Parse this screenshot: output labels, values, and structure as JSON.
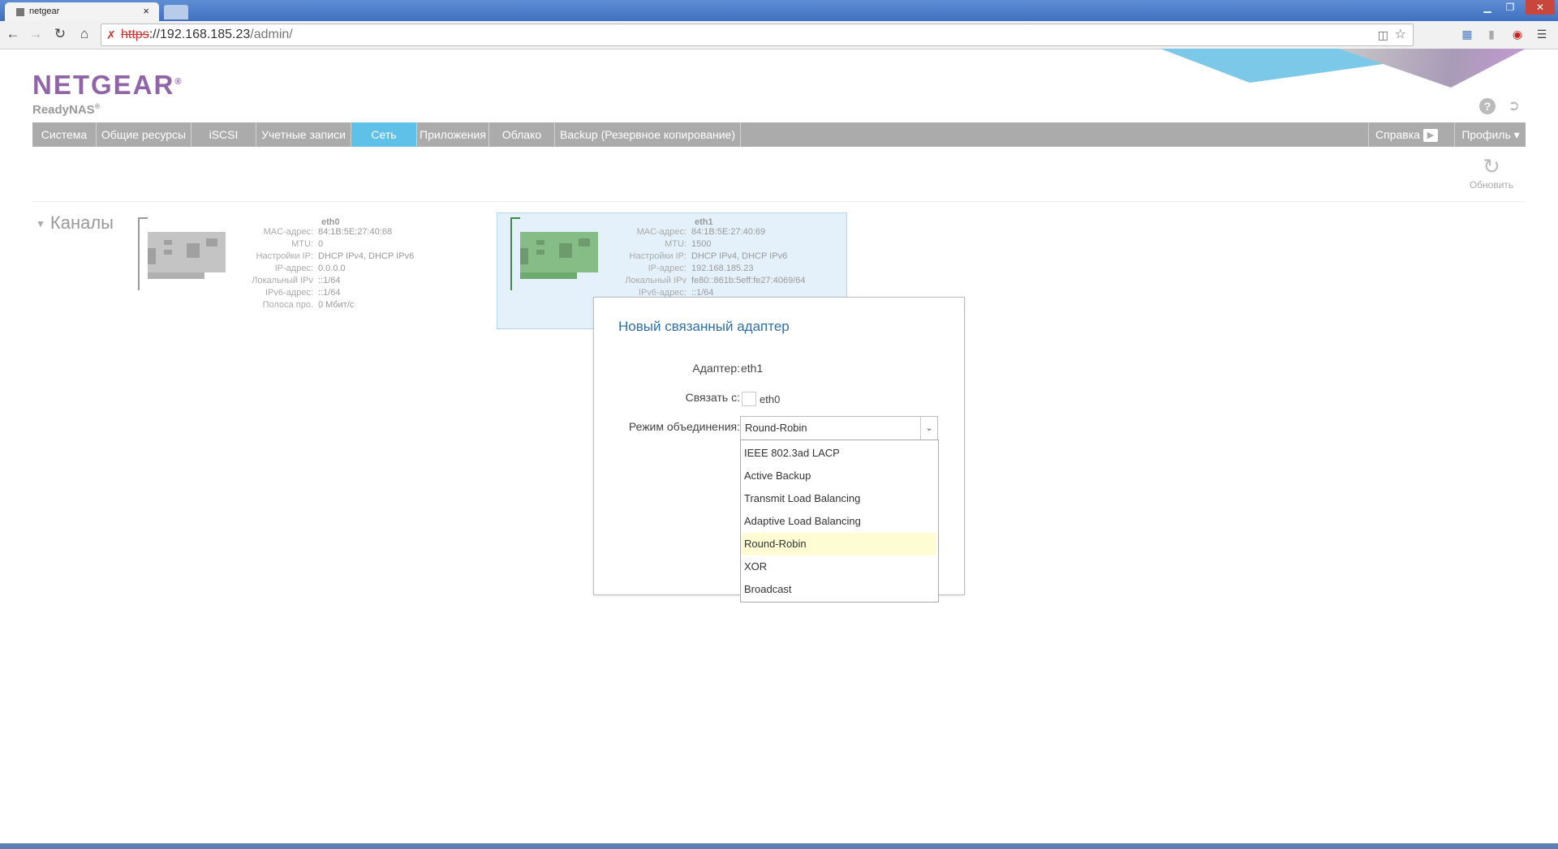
{
  "browser": {
    "tab_title": "netgear",
    "tab_close": "×",
    "url_https": "https",
    "url_host": "://192.168.185.23",
    "url_path": "/admin/",
    "win_min": "▁",
    "win_max": "❐",
    "win_close": "✕"
  },
  "app": {
    "brand": "NETGEAR",
    "brand_reg": "®",
    "product": "ReadyNAS",
    "product_reg": "®"
  },
  "menu": {
    "items": [
      "Система",
      "Общие ресурсы",
      "iSCSI",
      "Учетные записи",
      "Сеть",
      "Приложения",
      "Облако",
      "Backup (Резервное копирование)"
    ],
    "active": "Сеть",
    "help": "Справка",
    "profile": "Профиль ▾"
  },
  "refresh_label": "Обновить",
  "section_title": "Каналы",
  "nics": [
    {
      "name": "eth0",
      "rows": [
        {
          "label": "MAC-адрес:",
          "value": "84:1B:5E:27:40:68"
        },
        {
          "label": "MTU:",
          "value": "0"
        },
        {
          "label": "Настройки IP:",
          "value": "DHCP IPv4, DHCP IPv6"
        },
        {
          "label": "IP-адрес:",
          "value": "0.0.0.0"
        },
        {
          "label": "Локальный IPv",
          "value": "::1/64"
        },
        {
          "label": "IPv6-адрес:",
          "value": "::1/64"
        },
        {
          "label": "Полоса про.",
          "value": "0 Мбит/с"
        }
      ]
    },
    {
      "name": "eth1",
      "rows": [
        {
          "label": "MAC-адрес:",
          "value": "84:1B:5E:27:40:69"
        },
        {
          "label": "MTU:",
          "value": "1500"
        },
        {
          "label": "Настройки IP:",
          "value": "DHCP IPv4, DHCP IPv6"
        },
        {
          "label": "IP-адрес:",
          "value": "192.168.185.23"
        },
        {
          "label": "Локальный IPv",
          "value": "fe80::861b:5eff:fe27:4069/64"
        },
        {
          "label": "IPv6-адрес:",
          "value": "::1/64"
        }
      ]
    }
  ],
  "dialog": {
    "title": "Новый связанный адаптер",
    "adapter_label": "Адаптер:",
    "adapter_value": "eth1",
    "bind_label": "Связать с:",
    "bind_option": "eth0",
    "mode_label": "Режим объединения:",
    "mode_value": "Round-Robin",
    "options": [
      "IEEE 802.3ad LACP",
      "Active Backup",
      "Transmit Load Balancing",
      "Adaptive Load Balancing",
      "Round-Robin",
      "XOR",
      "Broadcast"
    ],
    "selected_option": "Round-Robin"
  },
  "colors": {
    "brand": "#8f65a8",
    "menu_bg": "#ababab",
    "menu_active": "#5fc0e8",
    "selection": "#e4f1fb",
    "dialog_title": "#2d6fa8",
    "option_highlight": "#fefcd2",
    "nic_inactive": "#bcbcbc",
    "nic_active": "#7ab87a"
  }
}
